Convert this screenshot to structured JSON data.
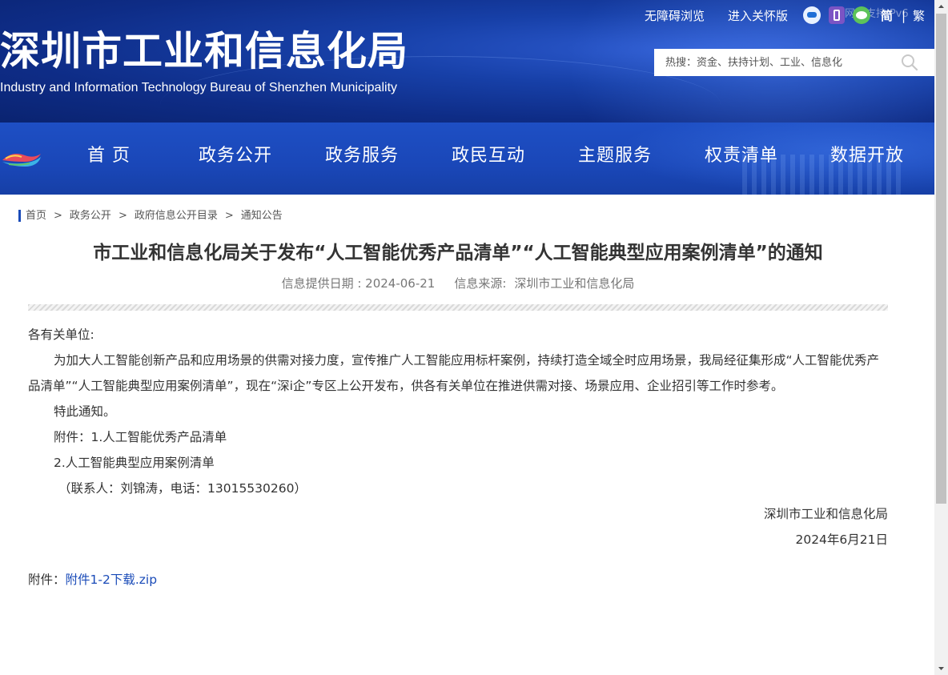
{
  "header": {
    "title": "深圳市工业和信息化局",
    "subtitle": "Industry and Information Technology Bureau of Shenzhen Municipality",
    "links": {
      "accessible": "无障碍浏览",
      "care_mode": "进入关怀版",
      "ipv6": "网站支持IPv6",
      "simplified": "简",
      "separator": "|",
      "traditional": "繁"
    },
    "icons": {
      "robot": "robot-assistant-icon",
      "phone": "mobile-icon",
      "wechat": "wechat-icon",
      "search": "search-icon"
    },
    "search": {
      "placeholder": "热搜：资金、扶持计划、工业、信息化"
    }
  },
  "nav": {
    "items": [
      "首 页",
      "政务公开",
      "政务服务",
      "政民互动",
      "主题服务",
      "权责清单",
      "数据开放"
    ]
  },
  "breadcrumb": [
    "首页",
    "政务公开",
    "政府信息公开目录",
    "通知公告"
  ],
  "breadcrumb_separator": ">",
  "article": {
    "title": "市工业和信息化局关于发布“人工智能优秀产品清单”“人工智能典型应用案例清单”的通知",
    "date_label": "信息提供日期 : 2024-06-21",
    "source_label": "信息来源:",
    "source_value": "深圳市工业和信息化局",
    "salutation": "各有关单位:",
    "paragraph1": "为加大人工智能创新产品和应用场景的供需对接力度，宣传推广人工智能应用标杆案例，持续打造全域全时应用场景，我局经征集形成“人工智能优秀产品清单”“人工智能典型应用案例清单”，现在“深i企”专区上公开发布，供各有关单位在推进供需对接、场景应用、企业招引等工作时参考。",
    "notice": "特此通知。",
    "attachment_line1": "附件：1.人工智能优秀产品清单",
    "attachment_line2": "2.人工智能典型应用案例清单",
    "contact": "（联系人：刘锦涛，电话：13015530260）",
    "signature": "深圳市工业和信息化局",
    "sign_date": "2024年6月21日",
    "download_label": "附件：",
    "download_link": "附件1-2下载.zip"
  },
  "colors": {
    "header_blue": "#0e2c86",
    "nav_blue": "#1a47b8",
    "link_blue": "#1a4bb8",
    "text": "#333333"
  }
}
